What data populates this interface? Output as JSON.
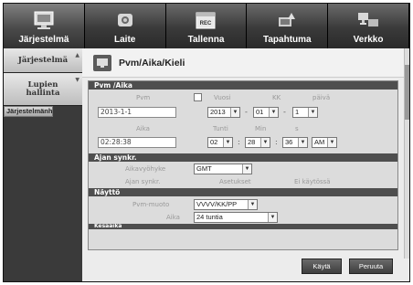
{
  "nav": {
    "tabs": [
      {
        "label": "Järjestelmä",
        "icon": "monitor-icon"
      },
      {
        "label": "Laite",
        "icon": "camera-icon"
      },
      {
        "label": "Tallenna",
        "icon": "rec-icon"
      },
      {
        "label": "Tapahtuma",
        "icon": "event-icon"
      },
      {
        "label": "Verkko",
        "icon": "network-icon"
      }
    ]
  },
  "sidebar": {
    "items": [
      {
        "label": "Järjestelmä"
      },
      {
        "label": "Lupien hallinta"
      },
      {
        "label": "Järjestelmänh"
      }
    ]
  },
  "page": {
    "title": "Pvm/Aika/Kieli"
  },
  "date_time": {
    "section": "Pvm /Aika",
    "pvm_label": "Pvm",
    "pvm_value": "2013-1-1",
    "vuosi_label": "Vuosi",
    "kk_label": "KK",
    "paiva_label": "päivä",
    "vuosi_value": "2013",
    "kk_value": "01",
    "paiva_value": "1",
    "aika_label": "Aika",
    "aika_value": "02:28:38",
    "tunti_label": "Tunti",
    "min_label": "Min",
    "s_label": "s",
    "tunti_value": "02",
    "min_value": "28",
    "s_value": "36",
    "ampm_value": "AM"
  },
  "sync": {
    "section": "Ajan synkr.",
    "tz_label": "Aikavyöhyke",
    "tz_value": "GMT",
    "sync_label": "Ajan synkr.",
    "settings_label": "Asetukset",
    "status_value": "Ei käytössä"
  },
  "display": {
    "section": "Näyttö",
    "format_label": "Pvm-muoto",
    "format_value": "VVVV/KK/PP",
    "time_label": "Aika",
    "time_value": "24 tuntia"
  },
  "partial_section": "Kesäaika",
  "buttons": {
    "apply": "Käytä",
    "cancel": "Peruuta"
  }
}
